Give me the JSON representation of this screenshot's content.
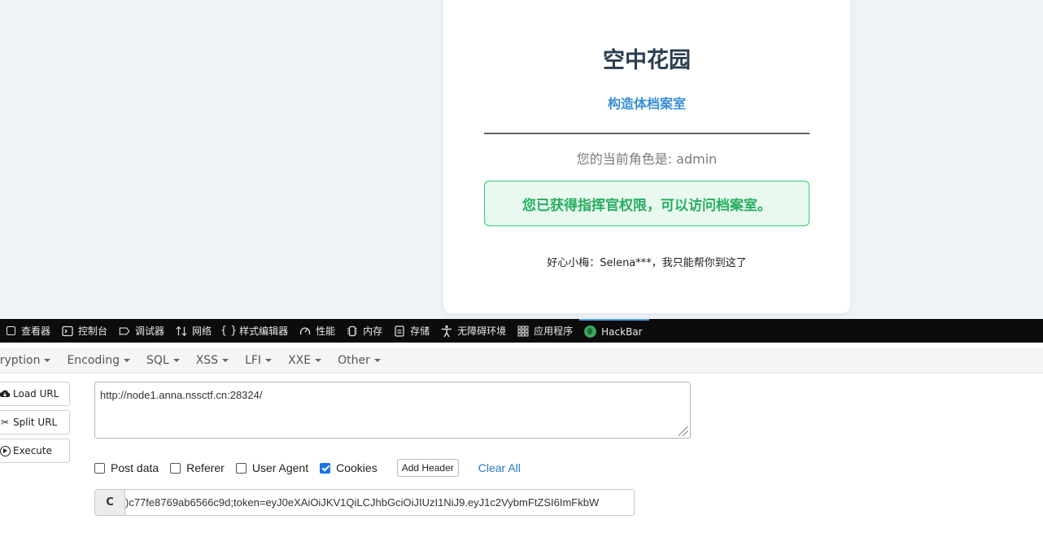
{
  "page": {
    "title": "空中花园",
    "subtitle": "构造体档案室",
    "role_text": "您的当前角色是: admin",
    "success_message": "您已获得指挥官权限，可以访问档案室。",
    "hint": "好心小梅：Selena***，我只能帮你到这了"
  },
  "devtools": {
    "tabs": [
      {
        "label": "查看器",
        "icon": "inspector-icon"
      },
      {
        "label": "控制台",
        "icon": "console-icon"
      },
      {
        "label": "调试器",
        "icon": "debugger-icon"
      },
      {
        "label": "网络",
        "icon": "network-icon"
      },
      {
        "label": "样式编辑器",
        "icon": "style-editor-icon"
      },
      {
        "label": "性能",
        "icon": "performance-icon"
      },
      {
        "label": "内存",
        "icon": "memory-icon"
      },
      {
        "label": "存储",
        "icon": "storage-icon"
      },
      {
        "label": "无障碍环境",
        "icon": "accessibility-icon"
      },
      {
        "label": "应用程序",
        "icon": "application-icon"
      },
      {
        "label": "HackBar",
        "icon": "hackbar-icon"
      }
    ],
    "active_tab": "HackBar"
  },
  "hackbar": {
    "menu": [
      "cryption",
      "Encoding",
      "SQL",
      "XSS",
      "LFI",
      "XXE",
      "Other"
    ],
    "buttons": {
      "load_url": "Load URL",
      "split_url": "Split URL",
      "execute": "Execute"
    },
    "url": "http://node1.anna.nssctf.cn:28324/",
    "options": {
      "post_data": {
        "label": "Post data",
        "checked": false
      },
      "referer": {
        "label": "Referer",
        "checked": false
      },
      "user_agent": {
        "label": "User Agent",
        "checked": false
      },
      "cookies": {
        "label": "Cookies",
        "checked": true
      }
    },
    "add_header": "Add Header",
    "clear_all": "Clear All",
    "cookie_prefix": "C",
    "cookie_value": ")c77fe8769ab6566c9d;token=eyJ0eXAiOiJKV1QiLCJhbGciOiJIUzI1NiJ9.eyJ1c2VybmFtZSI6ImFkbW"
  },
  "colors": {
    "accent": "#3a8fd6",
    "success": "#27ae60",
    "devtools_bg": "#0c0c0d",
    "active_tab": "#4a9fe8"
  }
}
